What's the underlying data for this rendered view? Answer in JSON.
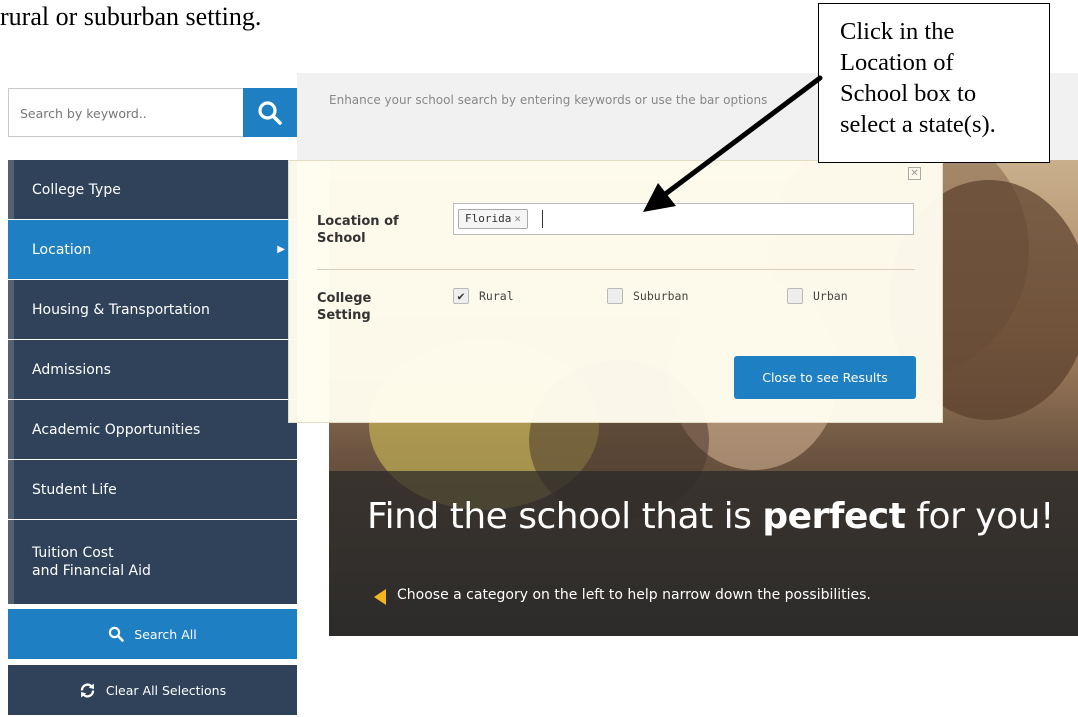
{
  "document": {
    "caption": "rural or suburban setting."
  },
  "callout": {
    "lines": [
      "Click in the",
      "Location of",
      "School box to",
      "select a state(s)."
    ]
  },
  "search": {
    "placeholder": "Search by keyword..",
    "hint": "Enhance your school search by entering keywords or use the bar options"
  },
  "sidebar": {
    "items": [
      {
        "label": "College Type"
      },
      {
        "label": "Location"
      },
      {
        "label": "Housing & Transportation"
      },
      {
        "label": "Admissions"
      },
      {
        "label": "Academic Opportunities"
      },
      {
        "label": "Student Life"
      },
      {
        "label": "Tuition Cost",
        "label2": "and Financial Aid"
      }
    ],
    "search_all": "Search All",
    "clear_all": "Clear All Selections"
  },
  "modal": {
    "location_label_1": "Location of",
    "location_label_2": "School",
    "selected_tag": "Florida",
    "setting_label_1": "College",
    "setting_label_2": "Setting",
    "options": [
      {
        "label": "Rural",
        "checked": true
      },
      {
        "label": "Suburban",
        "checked": false
      },
      {
        "label": "Urban",
        "checked": false
      }
    ],
    "close_button": "Close to see Results"
  },
  "hero": {
    "title_pre": "Find the school that is ",
    "title_bold": "perfect",
    "title_post": " for you!",
    "subtitle": "Choose a category on the left to help narrow down the possibilities."
  },
  "colors": {
    "primary": "#1f7fc3",
    "sidebar": "#2f4259",
    "accent": "#f3b51c"
  },
  "icons": {
    "search": "magnifier-icon",
    "refresh": "refresh-icon",
    "close": "close-icon",
    "check": "check-icon"
  }
}
